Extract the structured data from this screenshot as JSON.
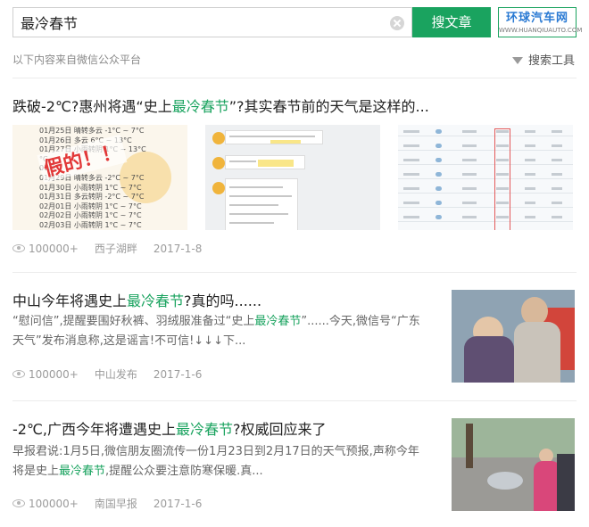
{
  "search": {
    "query": "最冷春节",
    "button_label": "搜文章"
  },
  "site_logo": {
    "name": "环球汽车网",
    "url": "WWW.HUANQIUAUTO.COM"
  },
  "source_note": "以下内容来自微信公众平台",
  "tools_label": "搜索工具",
  "results": [
    {
      "title_pre": "跌破-2℃?惠州将遇“史上",
      "title_hl": "最冷春节",
      "title_post": "”?其实春节前的天气是这样的...",
      "views": "100000+",
      "account": "西子湖畔",
      "date": "2017-1-8",
      "thumb1": {
        "lines": [
          "01月25日 晴转多云 -1°C ~ 7°C",
          "01月26日 多云 6°C ~ 13°C",
          "01月27日 小雨转阴 1°C ~ 13°C",
          "°C",
          "01月",
          "01月29日 晴转多云 -2°C ~ 7°C",
          "01月30日 小雨转阴 1°C ~ 7°C",
          "01月31日 多云转阴 -2°C ~ 7°C",
          "02月01日 小雨转阴 1°C ~ 7°C",
          "02月02日 小雨转阴 1°C ~ 7°C",
          "02月03日 小雨转阴 1°C ~ 7°C"
        ],
        "stamp": "假的",
        "stamp_bang": "！！"
      }
    },
    {
      "title_pre": "中山今年将遇史上",
      "title_hl": "最冷春节",
      "title_post": "?真的吗......",
      "summary_l1_pre": "“慰问信”,提醒要围好秋裤、羽绒服准备过“史上",
      "summary_l1_hl": "最冷春节",
      "summary_l1_post": "”......今天,微信号“广东",
      "summary_l2": "天气”发布消息称,这是谣言!不可信!↓↓↓下...",
      "views": "100000+",
      "account": "中山发布",
      "date": "2017-1-6"
    },
    {
      "title_pre": "-2℃,广西今年将遭遇史上",
      "title_hl": "最冷春节",
      "title_post": "?权威回应来了",
      "summary_l1": "早报君说:1月5日,微信朋友圈流传一份1月23日到2月17日的天气预报,声称今年",
      "summary_l2_pre": "将是史上",
      "summary_l2_hl": "最冷春节",
      "summary_l2_post": ",提醒公众要注意防寒保暖.真...",
      "views": "100000+",
      "account": "南国早报",
      "date": "2017-1-6"
    }
  ],
  "colors": {
    "accent": "#1aa35f",
    "highlight_text": "#1aa35f"
  }
}
